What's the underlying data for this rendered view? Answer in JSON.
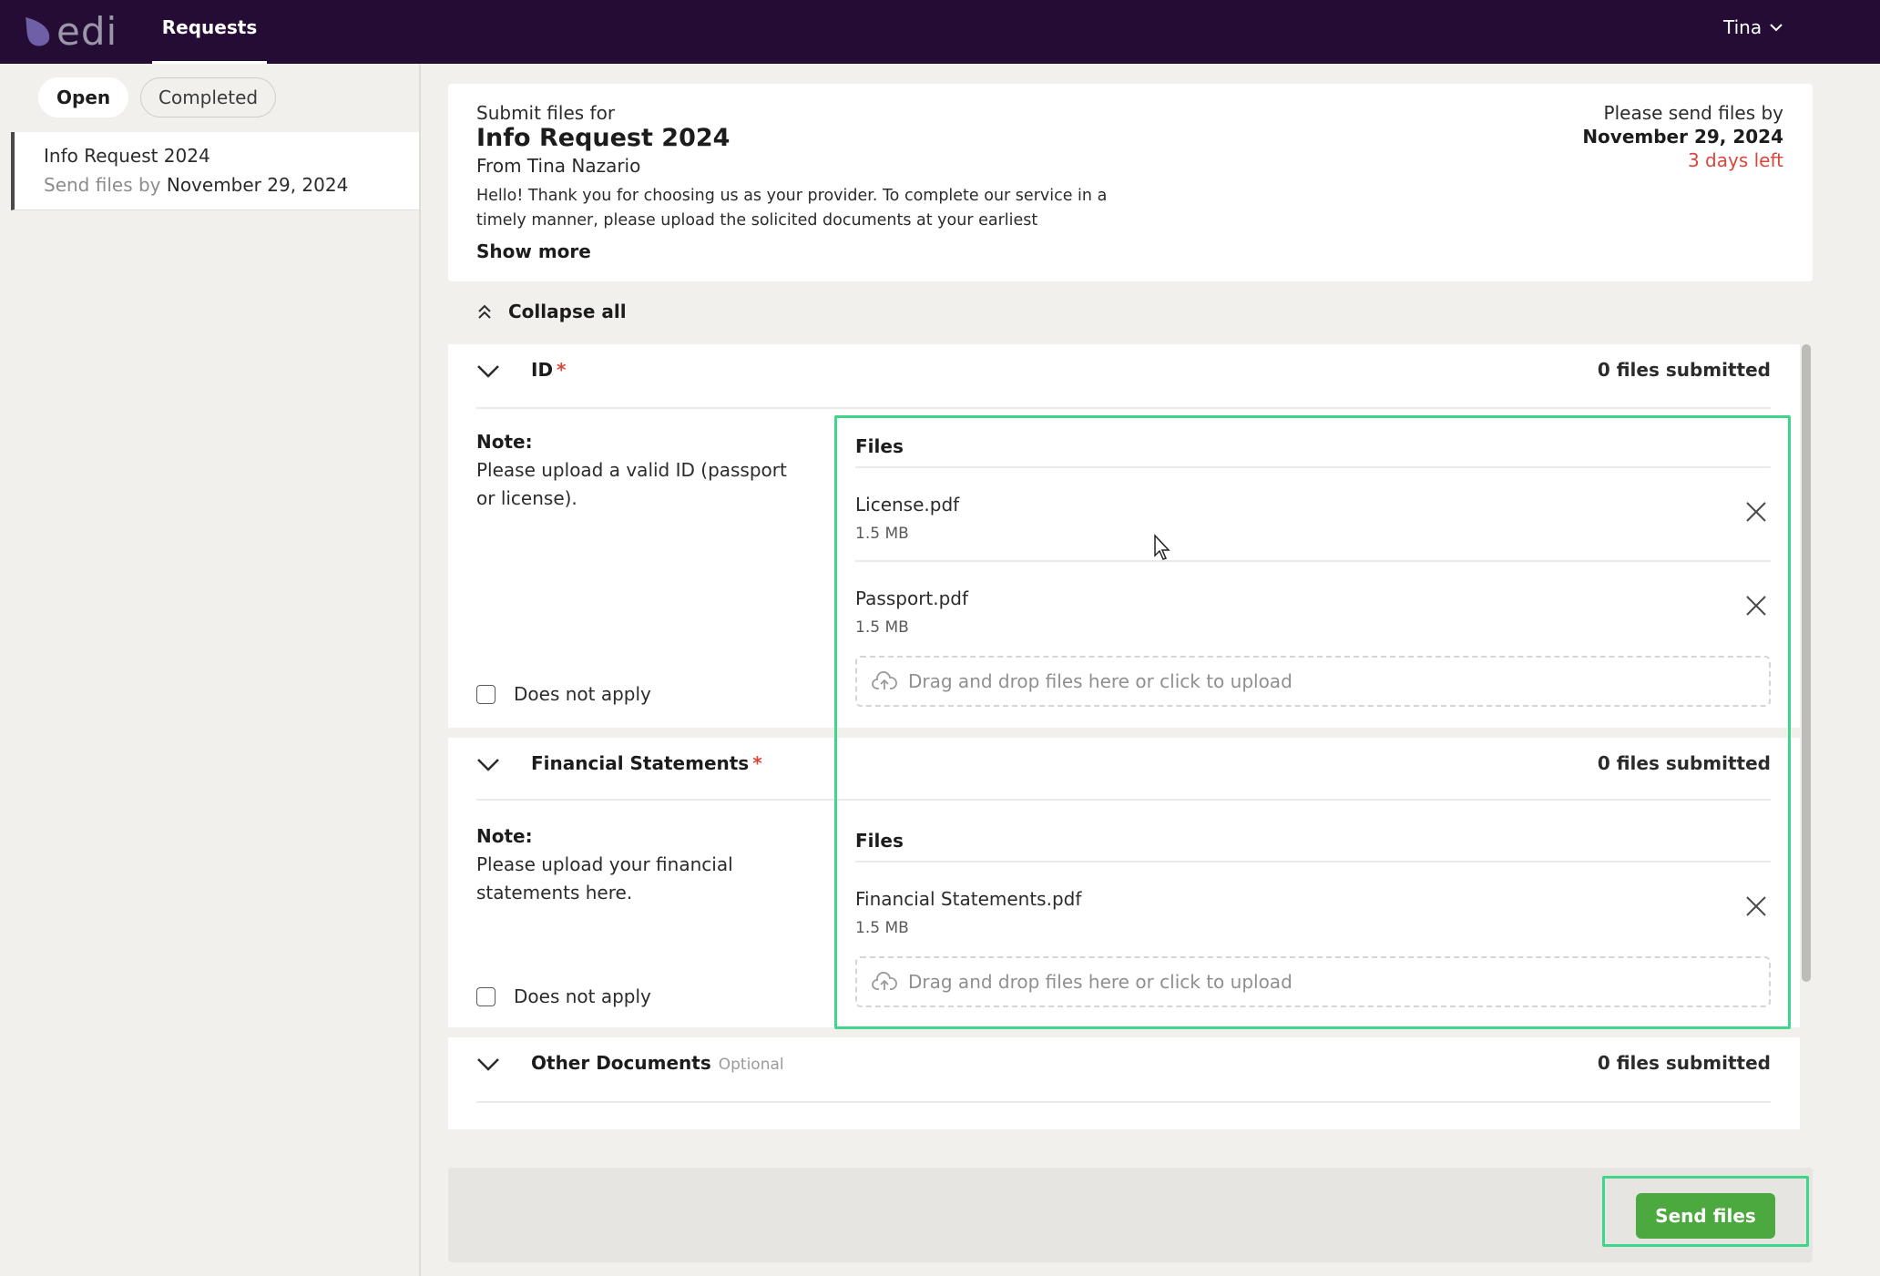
{
  "topbar": {
    "logo_text": "edi",
    "nav_tab": "Requests",
    "user": "Tina"
  },
  "sidebar": {
    "tabs": [
      {
        "label": "Open",
        "active": true
      },
      {
        "label": "Completed",
        "active": false
      }
    ],
    "requests": [
      {
        "title": "Info Request 2024",
        "due_prefix": "Send files by",
        "due_date": "November 29, 2024"
      }
    ]
  },
  "header": {
    "submit_for": "Submit files for",
    "title": "Info Request 2024",
    "from": "From Tina Nazario",
    "message": "Hello! Thank you for choosing us as your provider. To complete our service in a timely manner, please upload the solicited documents at your earliest",
    "show_more": "Show more",
    "deadline_label": "Please send files by",
    "deadline_date": "November 29, 2024",
    "days_left": "3 days left"
  },
  "collapse_all": "Collapse all",
  "sections": [
    {
      "title": "ID",
      "required_mark": "*",
      "submitted": "0 files submitted",
      "note_label": "Note:",
      "note": "Please upload a valid ID (passport or license).",
      "does_not_apply": "Does not apply",
      "files_label": "Files",
      "files": [
        {
          "name": "License.pdf",
          "size": "1.5 MB"
        },
        {
          "name": "Passport.pdf",
          "size": "1.5 MB"
        }
      ],
      "dropzone": "Drag and drop files here or click to upload"
    },
    {
      "title": "Financial Statements",
      "required_mark": "*",
      "submitted": "0 files submitted",
      "note_label": "Note:",
      "note": "Please upload your financial statements here.",
      "does_not_apply": "Does not apply",
      "files_label": "Files",
      "files": [
        {
          "name": "Financial Statements.pdf",
          "size": "1.5 MB"
        }
      ],
      "dropzone": "Drag and drop files here or click to upload"
    },
    {
      "title": "Other Documents",
      "optional_label": "Optional",
      "submitted": "0 files submitted"
    }
  ],
  "footer": {
    "send_button": "Send files"
  },
  "colors": {
    "topbar": "#250c34",
    "accent_red": "#d9463b",
    "send_green": "#4ca93f",
    "highlight": "#3fd68a"
  }
}
